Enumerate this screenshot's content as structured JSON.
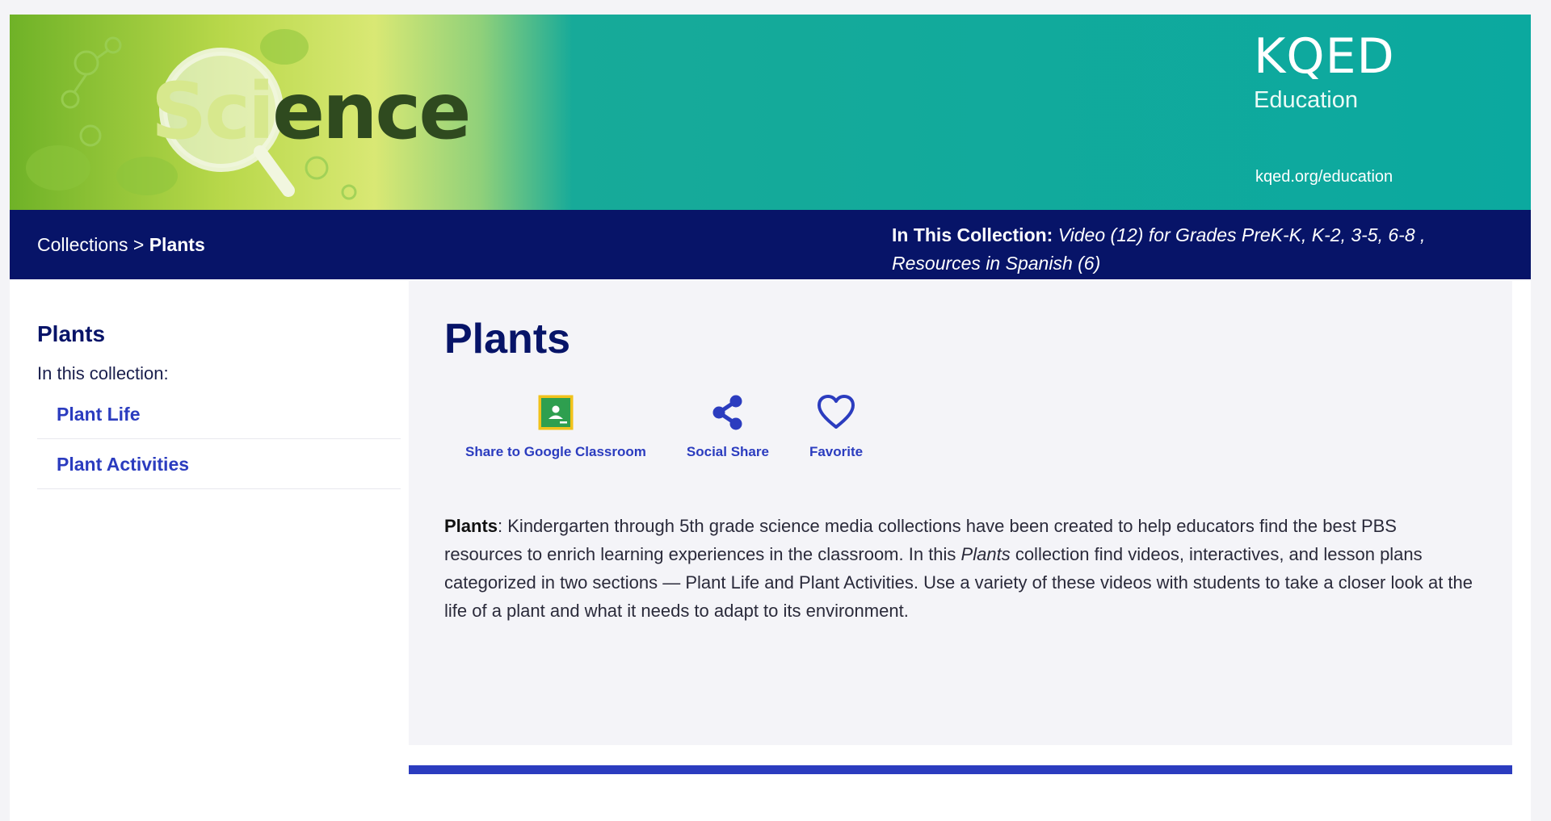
{
  "banner": {
    "science_word_lite": "Sci",
    "science_word_dark": "ence",
    "logo_wordmark": "KQED",
    "logo_sub": "Education",
    "url": "kqed.org/education"
  },
  "navbar": {
    "breadcrumb_root": "Collections",
    "breadcrumb_sep": ">",
    "breadcrumb_current": "Plants",
    "in_collection_label": "In This Collection:",
    "in_collection_text": "Video (12) for Grades PreK-K, K-2, 3-5, 6-8 , Resources in Spanish (6)"
  },
  "sidebar": {
    "title": "Plants",
    "subtitle": "In this collection:",
    "items": [
      {
        "label": "Plant Life"
      },
      {
        "label": "Plant Activities"
      }
    ]
  },
  "main": {
    "title": "Plants",
    "actions": [
      {
        "label": "Share to Google Classroom",
        "icon": "google-classroom-icon"
      },
      {
        "label": "Social Share",
        "icon": "share-icon"
      },
      {
        "label": "Favorite",
        "icon": "heart-icon"
      }
    ],
    "description": {
      "lead": "Plants",
      "part1": ": Kindergarten through 5th grade science media collections have been created to help educators find the best PBS resources to enrich learning experiences in the classroom. In this ",
      "italic": "Plants",
      "part2": " collection find videos, interactives, and lesson plans categorized in two sections — Plant Life and Plant Activities. Use a variety of these videos with students to take a closer look at the life of a plant and what it needs to adapt to its environment."
    }
  },
  "colors": {
    "teal": "#0ba99f",
    "navy": "#071468",
    "link_blue": "#2b3cbf",
    "classroom_green": "#2e9f4f",
    "classroom_border": "#f1c21b"
  }
}
